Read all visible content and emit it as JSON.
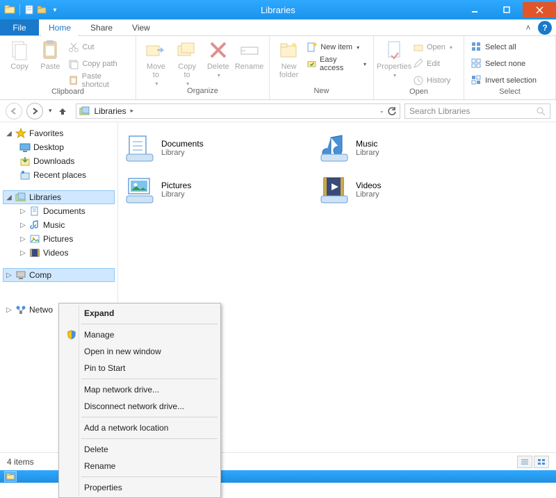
{
  "window": {
    "title": "Libraries"
  },
  "tabs": {
    "file": "File",
    "home": "Home",
    "share": "Share",
    "view": "View"
  },
  "ribbon": {
    "clipboard": {
      "label": "Clipboard",
      "copy": "Copy",
      "paste": "Paste",
      "cut": "Cut",
      "copy_path": "Copy path",
      "paste_shortcut": "Paste shortcut"
    },
    "organize": {
      "label": "Organize",
      "move_to": "Move\nto",
      "copy_to": "Copy\nto",
      "delete": "Delete",
      "rename": "Rename"
    },
    "new": {
      "label": "New",
      "new_folder": "New\nfolder",
      "new_item": "New item",
      "easy_access": "Easy access"
    },
    "open": {
      "label": "Open",
      "properties": "Properties",
      "open": "Open",
      "edit": "Edit",
      "history": "History"
    },
    "select": {
      "label": "Select",
      "select_all": "Select all",
      "select_none": "Select none",
      "invert": "Invert selection"
    }
  },
  "nav": {
    "breadcrumb": "Libraries",
    "search_placeholder": "Search Libraries"
  },
  "tree": {
    "favorites": {
      "label": "Favorites",
      "items": [
        "Desktop",
        "Downloads",
        "Recent places"
      ]
    },
    "libraries": {
      "label": "Libraries",
      "items": [
        "Documents",
        "Music",
        "Pictures",
        "Videos"
      ]
    },
    "computer": {
      "label": "Computer"
    },
    "network": {
      "label": "Network"
    }
  },
  "content": {
    "items": [
      {
        "title": "Documents",
        "sub": "Library"
      },
      {
        "title": "Music",
        "sub": "Library"
      },
      {
        "title": "Pictures",
        "sub": "Library"
      },
      {
        "title": "Videos",
        "sub": "Library"
      }
    ]
  },
  "status": {
    "count": "4 items"
  },
  "context_menu": {
    "items": [
      "Expand",
      "Manage",
      "Open in new window",
      "Pin to Start",
      "Map network drive...",
      "Disconnect network drive...",
      "Add a network location",
      "Delete",
      "Rename",
      "Properties"
    ]
  }
}
